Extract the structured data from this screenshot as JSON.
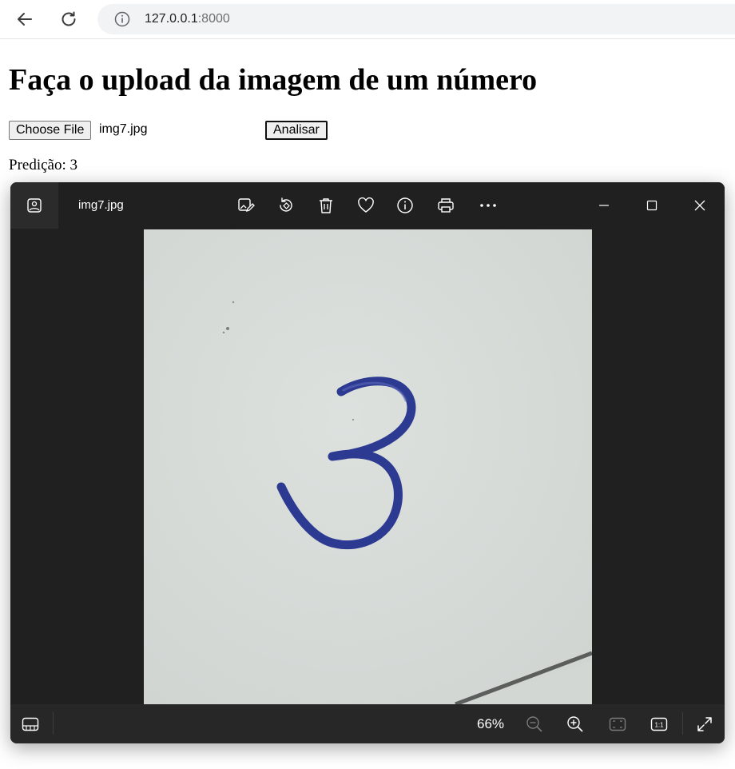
{
  "browser": {
    "url_host": "127.0.0.1",
    "url_port": ":8000"
  },
  "page": {
    "title": "Faça o upload da imagem de um número",
    "choose_file_label": "Choose File",
    "chosen_file_name": "img7.jpg",
    "submit_label": "Analisar",
    "prediction_text": "Predição: 3"
  },
  "viewer": {
    "file_title": "img7.jpg",
    "zoom_level": "66%",
    "fit_label": "1:1",
    "toolbar_icons": [
      "edit-image-icon",
      "rotate-icon",
      "delete-icon",
      "favorite-icon",
      "info-icon",
      "print-icon",
      "more-icon"
    ],
    "window_controls": [
      "minimize-icon",
      "maximize-icon",
      "close-icon"
    ],
    "photo_digit": "3"
  },
  "colors": {
    "viewer_bg": "#202020",
    "viewer_bottom": "#272727",
    "paper": "#d7dbd8",
    "ink": "#2c3a93"
  }
}
